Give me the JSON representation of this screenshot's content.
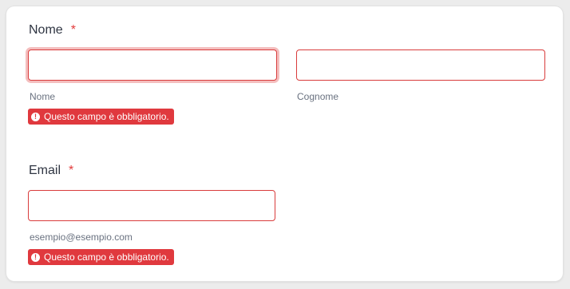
{
  "name_field": {
    "label": "Nome",
    "required_mark": "*",
    "first_value": "",
    "last_value": "",
    "first_sublabel": "Nome",
    "last_sublabel": "Cognome",
    "error_text": "Questo campo è obbligatorio.",
    "error_icon": "exclamation-circle-icon"
  },
  "email_field": {
    "label": "Email",
    "required_mark": "*",
    "value": "",
    "sublabel": "esempio@esempio.com",
    "error_text": "Questo campo è obbligatorio.",
    "error_icon": "exclamation-circle-icon"
  },
  "colors": {
    "error": "#e0393e",
    "required": "#e23b3b",
    "text": "#2f3542",
    "muted": "#6a7280"
  }
}
